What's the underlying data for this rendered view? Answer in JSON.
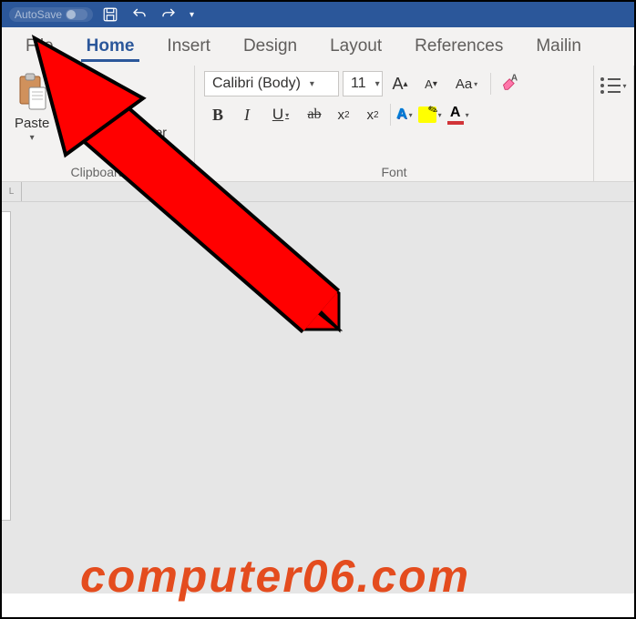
{
  "titlebar": {
    "autosave_label": "AutoSave"
  },
  "tabs": {
    "file": "File",
    "home": "Home",
    "insert": "Insert",
    "design": "Design",
    "layout": "Layout",
    "references": "References",
    "mailings": "Mailin"
  },
  "ribbon": {
    "clipboard": {
      "paste": "Paste",
      "format_painter": "Format Painter",
      "label": "Clipboard"
    },
    "font": {
      "family": "Calibri (Body)",
      "size": "11",
      "grow_a": "A",
      "shrink_a": "A",
      "changecase": "Aa",
      "bold": "B",
      "italic": "I",
      "underline": "U",
      "strike": "ab",
      "subscript_x": "x",
      "subscript_2": "2",
      "superscript_x": "x",
      "superscript_2": "2",
      "texteffects_letter": "A",
      "highlight_color": "#ffff00",
      "fontcolor_letter": "A",
      "fontcolor_bar": "#d13438",
      "label": "Font"
    }
  },
  "ruler": {
    "left_mark": "L"
  },
  "watermark": "computer06.com",
  "colors": {
    "word_blue": "#2b579a",
    "ribbon_bg": "#f3f2f1",
    "accent_red": "#d13438",
    "text_effects": "#0078d4"
  }
}
